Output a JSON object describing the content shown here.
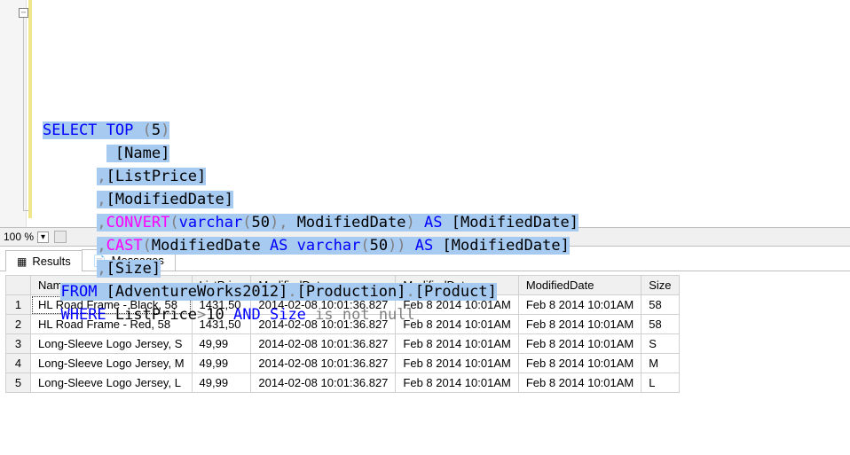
{
  "editor": {
    "fold_glyph": "−",
    "lines": [
      {
        "indent": 0,
        "tokens": [
          {
            "t": "SELECT",
            "c": "kw-blue",
            "sel": true
          },
          {
            "t": " ",
            "c": "plain",
            "sel": true
          },
          {
            "t": "TOP",
            "c": "kw-blue",
            "sel": true
          },
          {
            "t": " ",
            "c": "plain",
            "sel": true
          },
          {
            "t": "(",
            "c": "kw-gray",
            "sel": true
          },
          {
            "t": "5",
            "c": "plain",
            "sel": true
          },
          {
            "t": ")",
            "c": "kw-gray",
            "sel": true
          }
        ]
      },
      {
        "indent": 7,
        "tokens": [
          {
            "t": " [Name]",
            "c": "plain",
            "sel": true
          }
        ]
      },
      {
        "indent": 6,
        "tokens": [
          {
            "t": ",",
            "c": "kw-gray",
            "sel": true
          },
          {
            "t": "[ListPrice]",
            "c": "plain",
            "sel": true
          }
        ]
      },
      {
        "indent": 6,
        "tokens": [
          {
            "t": ",",
            "c": "kw-gray",
            "sel": true
          },
          {
            "t": "[ModifiedDate]",
            "c": "plain",
            "sel": true
          }
        ]
      },
      {
        "indent": 6,
        "tokens": [
          {
            "t": ",",
            "c": "kw-gray",
            "sel": true
          },
          {
            "t": "CONVERT",
            "c": "kw-magenta",
            "sel": true
          },
          {
            "t": "(",
            "c": "kw-gray",
            "sel": true
          },
          {
            "t": "varchar",
            "c": "kw-blue",
            "sel": true
          },
          {
            "t": "(",
            "c": "kw-gray",
            "sel": true
          },
          {
            "t": "50",
            "c": "plain",
            "sel": true
          },
          {
            "t": "),",
            "c": "kw-gray",
            "sel": true
          },
          {
            "t": " ModifiedDate",
            "c": "plain",
            "sel": true
          },
          {
            "t": ")",
            "c": "kw-gray",
            "sel": true
          },
          {
            "t": " ",
            "c": "plain",
            "sel": true
          },
          {
            "t": "AS",
            "c": "kw-blue",
            "sel": true
          },
          {
            "t": " [ModifiedDate]",
            "c": "plain",
            "sel": true
          }
        ]
      },
      {
        "indent": 6,
        "tokens": [
          {
            "t": ",",
            "c": "kw-gray",
            "sel": true
          },
          {
            "t": "CAST",
            "c": "kw-magenta",
            "sel": true
          },
          {
            "t": "(",
            "c": "kw-gray",
            "sel": true
          },
          {
            "t": "ModifiedDate ",
            "c": "plain",
            "sel": true
          },
          {
            "t": "AS",
            "c": "kw-blue",
            "sel": true
          },
          {
            "t": " ",
            "c": "plain",
            "sel": true
          },
          {
            "t": "varchar",
            "c": "kw-blue",
            "sel": true
          },
          {
            "t": "(",
            "c": "kw-gray",
            "sel": true
          },
          {
            "t": "50",
            "c": "plain",
            "sel": true
          },
          {
            "t": "))",
            "c": "kw-gray",
            "sel": true
          },
          {
            "t": " ",
            "c": "plain",
            "sel": true
          },
          {
            "t": "AS",
            "c": "kw-blue",
            "sel": true
          },
          {
            "t": " [ModifiedDate]",
            "c": "plain",
            "sel": true
          }
        ]
      },
      {
        "indent": 6,
        "tokens": [
          {
            "t": ",",
            "c": "kw-gray",
            "sel": true
          },
          {
            "t": "[Size]",
            "c": "plain",
            "sel": true
          }
        ]
      },
      {
        "indent": 2,
        "tokens": [
          {
            "t": "FROM",
            "c": "kw-blue",
            "sel": true
          },
          {
            "t": " [AdventureWorks2012]",
            "c": "plain",
            "sel": true
          },
          {
            "t": ".",
            "c": "kw-gray",
            "sel": true
          },
          {
            "t": "[Production]",
            "c": "plain",
            "sel": true
          },
          {
            "t": ".",
            "c": "kw-gray",
            "sel": true
          },
          {
            "t": "[Product]",
            "c": "plain",
            "sel": true
          }
        ]
      },
      {
        "indent": 2,
        "tokens": [
          {
            "t": "WHERE",
            "c": "kw-blue",
            "sel": false
          },
          {
            "t": " ListPrice",
            "c": "plain",
            "sel": false
          },
          {
            "t": ">",
            "c": "kw-gray",
            "sel": false
          },
          {
            "t": "10 ",
            "c": "plain",
            "sel": false
          },
          {
            "t": "AND",
            "c": "kw-blue",
            "sel": false
          },
          {
            "t": " ",
            "c": "plain",
            "sel": false
          },
          {
            "t": "Size",
            "c": "kw-blue",
            "sel": false
          },
          {
            "t": " ",
            "c": "plain",
            "sel": false
          },
          {
            "t": "is not null",
            "c": "kw-gray",
            "sel": false
          }
        ]
      }
    ]
  },
  "zoom": {
    "value": "100 %"
  },
  "tabs": {
    "results": {
      "label": "Results",
      "icon": "▦"
    },
    "messages": {
      "label": "Messages",
      "icon": "📄"
    }
  },
  "grid": {
    "columns": [
      "Name",
      "ListPrice",
      "ModifiedDate",
      "ModifiedDate",
      "ModifiedDate",
      "Size"
    ],
    "rows": [
      {
        "n": "1",
        "cells": [
          "HL Road Frame - Black, 58",
          "1431,50",
          "2014-02-08 10:01:36.827",
          "Feb  8 2014 10:01AM",
          "Feb  8 2014 10:01AM",
          "58"
        ]
      },
      {
        "n": "2",
        "cells": [
          "HL Road Frame - Red, 58",
          "1431,50",
          "2014-02-08 10:01:36.827",
          "Feb  8 2014 10:01AM",
          "Feb  8 2014 10:01AM",
          "58"
        ]
      },
      {
        "n": "3",
        "cells": [
          "Long-Sleeve Logo Jersey, S",
          "49,99",
          "2014-02-08 10:01:36.827",
          "Feb  8 2014 10:01AM",
          "Feb  8 2014 10:01AM",
          "S"
        ]
      },
      {
        "n": "4",
        "cells": [
          "Long-Sleeve Logo Jersey, M",
          "49,99",
          "2014-02-08 10:01:36.827",
          "Feb  8 2014 10:01AM",
          "Feb  8 2014 10:01AM",
          "M"
        ]
      },
      {
        "n": "5",
        "cells": [
          "Long-Sleeve Logo Jersey, L",
          "49,99",
          "2014-02-08 10:01:36.827",
          "Feb  8 2014 10:01AM",
          "Feb  8 2014 10:01AM",
          "L"
        ]
      }
    ]
  }
}
